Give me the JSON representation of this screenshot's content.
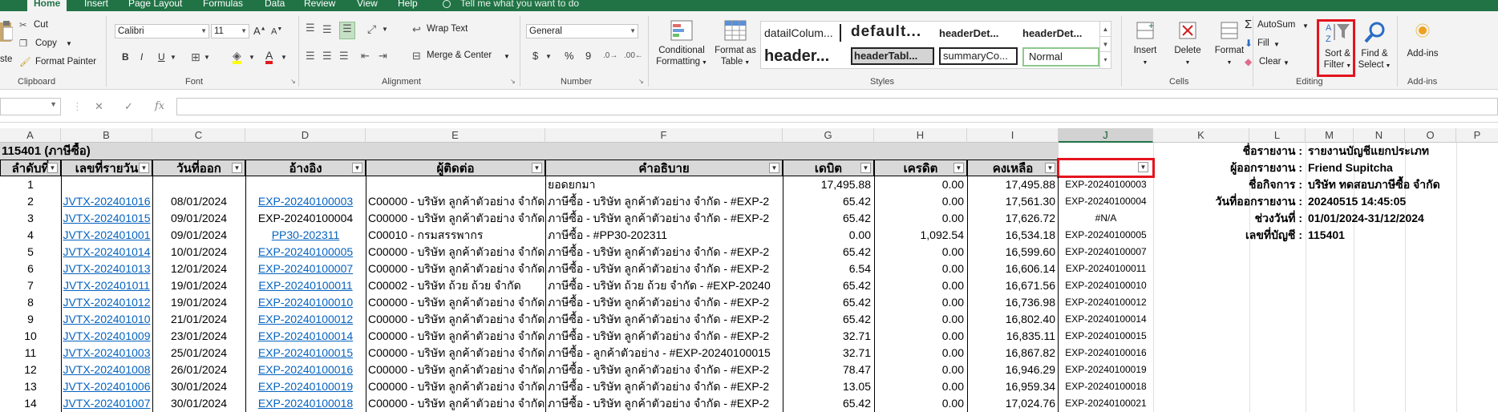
{
  "tabs": [
    "Home",
    "Insert",
    "Page Layout",
    "Formulas",
    "Data",
    "Review",
    "View",
    "Help"
  ],
  "tell_me": "Tell me what you want to do",
  "clipboard": {
    "paste": "ste",
    "cut": "Cut",
    "copy": "Copy",
    "format_painter": "Format Painter",
    "label": "Clipboard"
  },
  "font": {
    "name": "Calibri",
    "size": "11",
    "bold": "B",
    "italic": "I",
    "underline": "U",
    "label": "Font"
  },
  "alignment": {
    "wrap": "Wrap Text",
    "merge": "Merge & Center",
    "label": "Alignment"
  },
  "number": {
    "format": "General",
    "currency": "$",
    "percent": "%",
    "comma": "9",
    "label": "Number"
  },
  "styles": {
    "conditional": [
      "Conditional",
      "Formatting"
    ],
    "format_table": [
      "Format as",
      "Table"
    ],
    "items": [
      "datailColum...",
      "default...",
      "headerDet...",
      "headerDet...",
      "header...",
      "headerTabl...",
      "summaryCo...",
      "Normal"
    ],
    "label": "Styles"
  },
  "cells": {
    "insert": "Insert",
    "delete": "Delete",
    "format": "Format",
    "label": "Cells"
  },
  "editing": {
    "autosum": "AutoSum",
    "fill": "Fill",
    "clear": "Clear",
    "sort": [
      "Sort &",
      "Filter"
    ],
    "find": [
      "Find &",
      "Select"
    ],
    "label": "Editing"
  },
  "addins": {
    "btn": "Add-ins",
    "label": "Add-ins"
  },
  "columns": [
    "A",
    "B",
    "C",
    "D",
    "E",
    "F",
    "G",
    "H",
    "I",
    "J",
    "K",
    "L",
    "M",
    "N",
    "O",
    "P"
  ],
  "sheet_title": "115401 (ภาษีซื้อ)",
  "headers": [
    "ลำดับที่",
    "เลขที่รายวัน",
    "วันที่ออก",
    "อ้างอิง",
    "ผู้ติดต่อ",
    "คำอธิบาย",
    "เดบิต",
    "เครดิต",
    "คงเหลือ"
  ],
  "rows": [
    [
      "1",
      "",
      "",
      "",
      "",
      "ยอดยกมา",
      "17,495.88",
      "0.00",
      "17,495.88",
      "EXP-20240100003"
    ],
    [
      "2",
      "JVTX-202401016",
      "08/01/2024",
      "EXP-20240100003",
      "C00000 - บริษัท ลูกค้าตัวอย่าง จำกัด",
      "ภาษีซื้อ - บริษัท ลูกค้าตัวอย่าง จำกัด - #EXP-2",
      "65.42",
      "0.00",
      "17,561.30",
      "EXP-20240100004"
    ],
    [
      "3",
      "JVTX-202401015",
      "09/01/2024",
      "EXP-20240100004",
      "C00000 - บริษัท ลูกค้าตัวอย่าง จำกัด",
      "ภาษีซื้อ - บริษัท ลูกค้าตัวอย่าง จำกัด - #EXP-2",
      "65.42",
      "0.00",
      "17,626.72",
      "#N/A"
    ],
    [
      "4",
      "JVTX-202401001",
      "09/01/2024",
      "PP30-202311",
      "C00010 - กรมสรรพากร",
      "ภาษีซื้อ -  #PP30-202311",
      "0.00",
      "1,092.54",
      "16,534.18",
      "EXP-20240100005"
    ],
    [
      "5",
      "JVTX-202401014",
      "10/01/2024",
      "EXP-20240100005",
      "C00000 - บริษัท ลูกค้าตัวอย่าง จำกัด",
      "ภาษีซื้อ - บริษัท ลูกค้าตัวอย่าง จำกัด - #EXP-2",
      "65.42",
      "0.00",
      "16,599.60",
      "EXP-20240100007"
    ],
    [
      "6",
      "JVTX-202401013",
      "12/01/2024",
      "EXP-20240100007",
      "C00000 - บริษัท ลูกค้าตัวอย่าง จำกัด",
      "ภาษีซื้อ - บริษัท ลูกค้าตัวอย่าง จำกัด - #EXP-2",
      "6.54",
      "0.00",
      "16,606.14",
      "EXP-20240100011"
    ],
    [
      "7",
      "JVTX-202401011",
      "19/01/2024",
      "EXP-20240100011",
      "C00002 - บริษัท ถ้วย ถ้วย จำกัด",
      "ภาษีซื้อ - บริษัท ถ้วย ถ้วย จำกัด - #EXP-20240",
      "65.42",
      "0.00",
      "16,671.56",
      "EXP-20240100010"
    ],
    [
      "8",
      "JVTX-202401012",
      "19/01/2024",
      "EXP-20240100010",
      "C00000 - บริษัท ลูกค้าตัวอย่าง จำกัด",
      "ภาษีซื้อ - บริษัท ลูกค้าตัวอย่าง จำกัด - #EXP-2",
      "65.42",
      "0.00",
      "16,736.98",
      "EXP-20240100012"
    ],
    [
      "9",
      "JVTX-202401010",
      "21/01/2024",
      "EXP-20240100012",
      "C00000 - บริษัท ลูกค้าตัวอย่าง จำกัด",
      "ภาษีซื้อ - บริษัท ลูกค้าตัวอย่าง จำกัด - #EXP-2",
      "65.42",
      "0.00",
      "16,802.40",
      "EXP-20240100014"
    ],
    [
      "10",
      "JVTX-202401009",
      "23/01/2024",
      "EXP-20240100014",
      "C00000 - บริษัท ลูกค้าตัวอย่าง จำกัด",
      "ภาษีซื้อ - บริษัท ลูกค้าตัวอย่าง จำกัด - #EXP-2",
      "32.71",
      "0.00",
      "16,835.11",
      "EXP-20240100015"
    ],
    [
      "11",
      "JVTX-202401003",
      "25/01/2024",
      "EXP-20240100015",
      "C00000 - บริษัท ลูกค้าตัวอย่าง จำกัด",
      "ภาษีซื้อ - ลูกค้าตัวอย่าง - #EXP-20240100015",
      "32.71",
      "0.00",
      "16,867.82",
      "EXP-20240100016"
    ],
    [
      "12",
      "JVTX-202401008",
      "26/01/2024",
      "EXP-20240100016",
      "C00000 - บริษัท ลูกค้าตัวอย่าง จำกัด",
      "ภาษีซื้อ - บริษัท ลูกค้าตัวอย่าง จำกัด - #EXP-2",
      "78.47",
      "0.00",
      "16,946.29",
      "EXP-20240100019"
    ],
    [
      "13",
      "JVTX-202401006",
      "30/01/2024",
      "EXP-20240100019",
      "C00000 - บริษัท ลูกค้าตัวอย่าง จำกัด",
      "ภาษีซื้อ - บริษัท ลูกค้าตัวอย่าง จำกัด - #EXP-2",
      "13.05",
      "0.00",
      "16,959.34",
      "EXP-20240100018"
    ],
    [
      "14",
      "JVTX-202401007",
      "30/01/2024",
      "EXP-20240100018",
      "C00000 - บริษัท ลูกค้าตัวอย่าง จำกัด",
      "ภาษีซื้อ - บริษัท ลูกค้าตัวอย่าง จำกัด - #EXP-2",
      "65.42",
      "0.00",
      "17,024.76",
      "EXP-20240100021"
    ]
  ],
  "report": [
    [
      "ชื่อรายงาน :",
      "รายงานบัญชีแยกประเภท"
    ],
    [
      "ผู้ออกรายงาน :",
      "Friend Supitcha"
    ],
    [
      "ชื่อกิจการ :",
      "บริษัท ทดสอบภาษีซื้อ จำกัด"
    ],
    [
      "วันที่ออกรายงาน :",
      "20240515 14:45:05"
    ],
    [
      "ช่วงวันที่ :",
      "01/01/2024-31/12/2024"
    ],
    [
      "เลขที่บัญชี :",
      "115401"
    ]
  ],
  "colors": {
    "excel_green": "#217346",
    "highlight": "#e4141d",
    "link": "#0563c1"
  }
}
